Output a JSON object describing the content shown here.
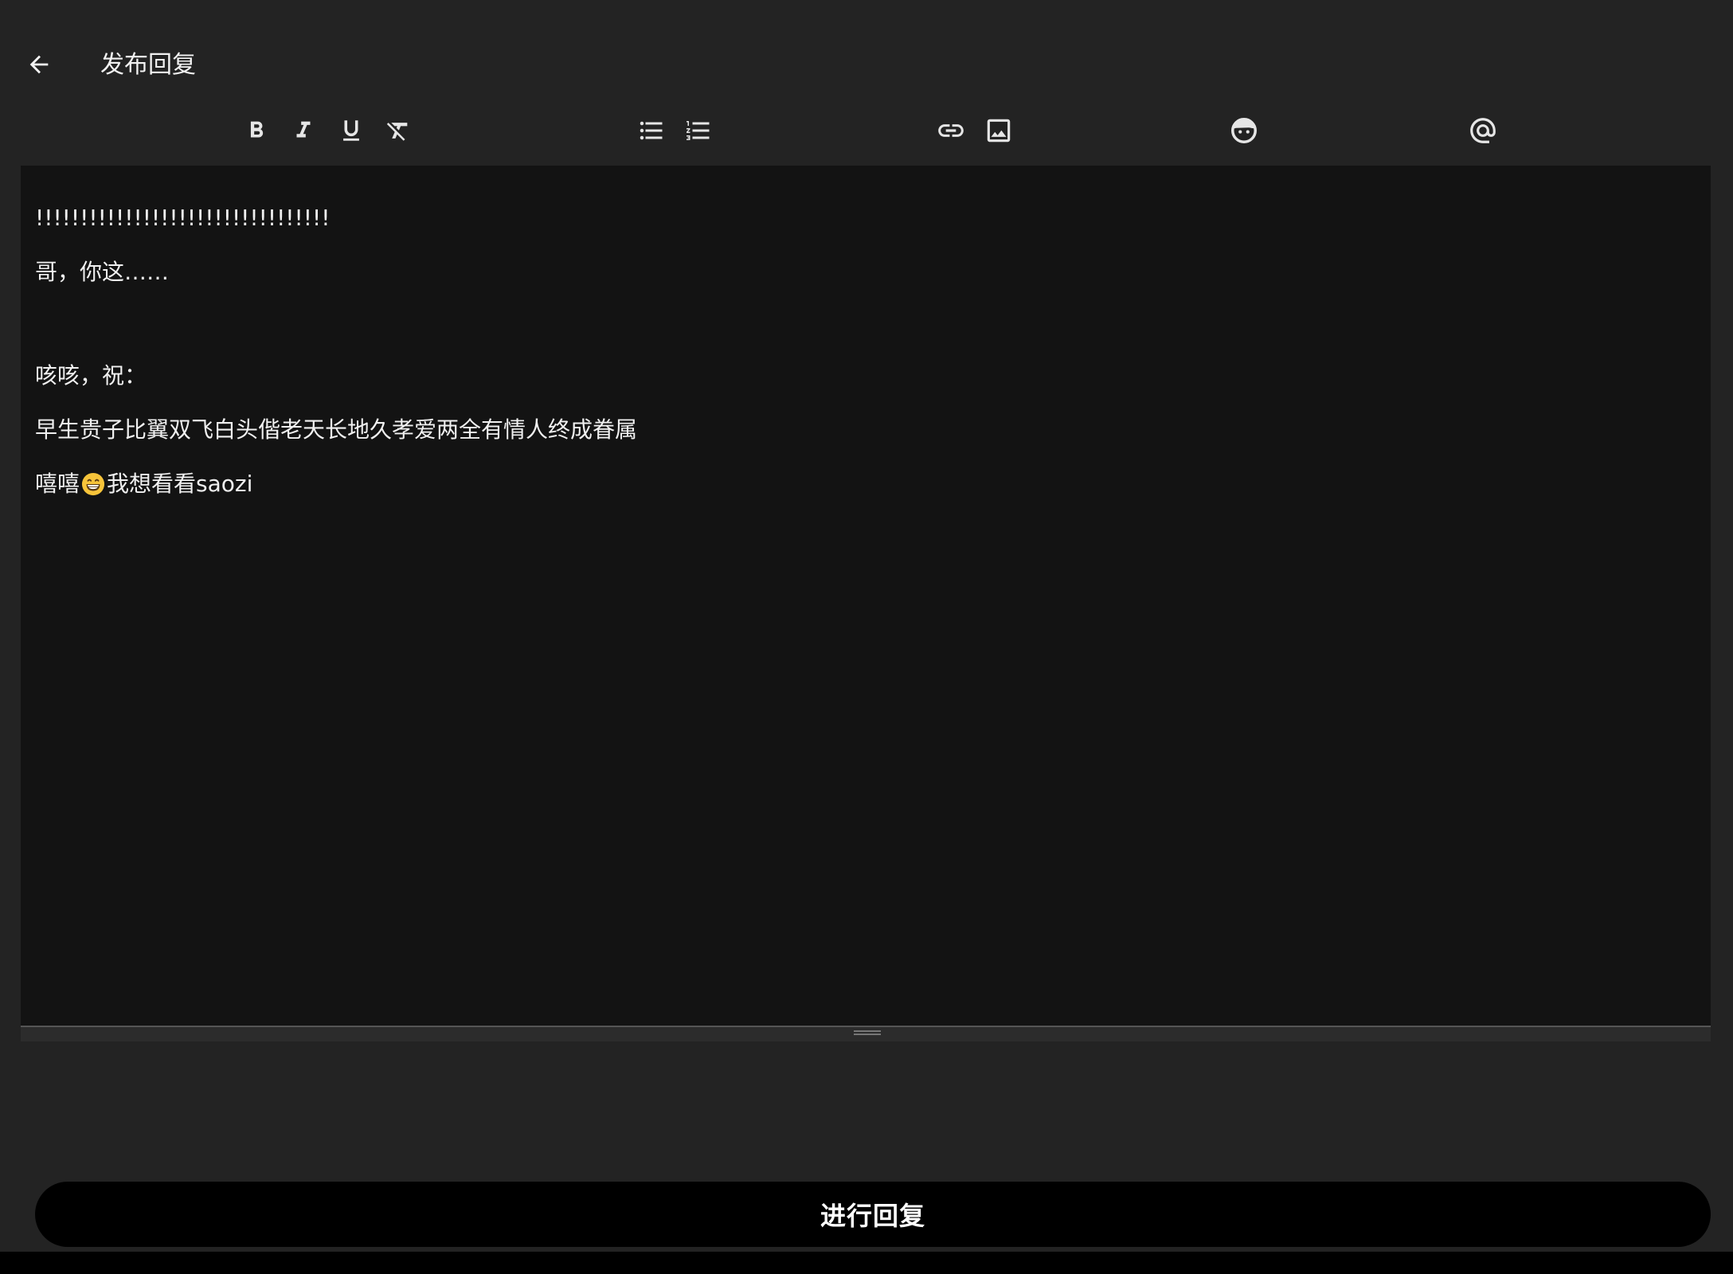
{
  "header": {
    "title": "发布回复",
    "back_icon": "arrow-left-icon"
  },
  "toolbar": {
    "icons": [
      "bold-icon",
      "italic-icon",
      "underline-icon",
      "clear-format-icon",
      "bullet-list-icon",
      "numbered-list-icon",
      "link-icon",
      "image-icon",
      "emoji-icon",
      "mention-icon"
    ]
  },
  "editor": {
    "lines": [
      "!!!!!!!!!!!!!!!!!!!!!!!!!!!!!!!!!",
      "哥，你这……",
      "咳咳，祝：",
      "早生贵子比翼双飞白头偕老天长地久孝爱两全有情人终成眷属",
      "嘻嘻"
    ],
    "line5_tail": "我想看看saozi",
    "emoji_icon": "grinning-face-icon"
  },
  "submit": {
    "label": "进行回复"
  },
  "colors": {
    "background": "#232323",
    "editor_bg": "#131313",
    "button_bg": "#000000",
    "text": "#ffffff"
  }
}
